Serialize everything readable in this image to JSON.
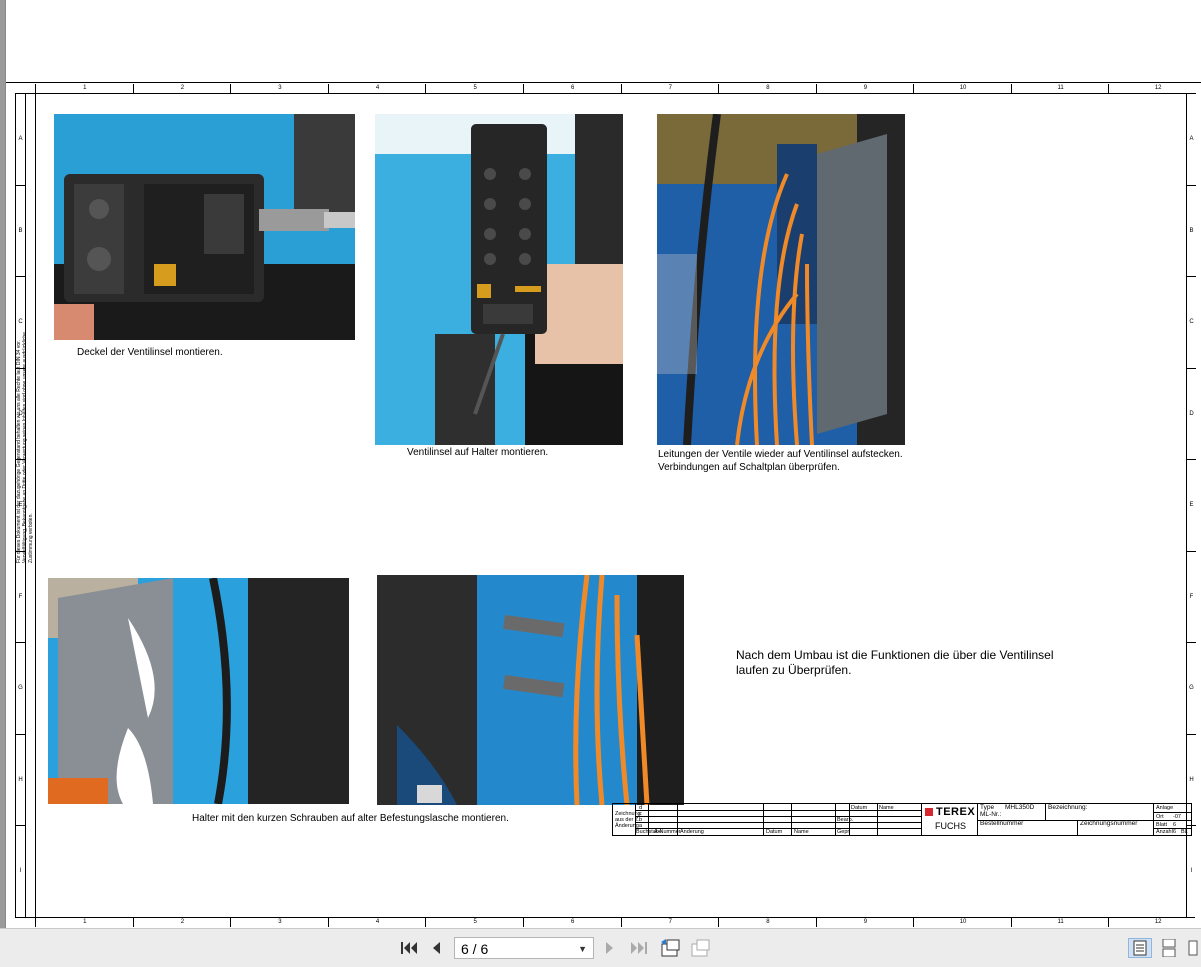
{
  "drawing": {
    "columns": [
      "1",
      "2",
      "3",
      "4",
      "5",
      "6",
      "7",
      "8",
      "9",
      "10",
      "11",
      "12"
    ],
    "rows": [
      "A",
      "B",
      "C",
      "D",
      "E",
      "F",
      "G",
      "H",
      "I"
    ],
    "legal_note_line1": "Für dieses Dokument ist der dazugehörige Gegenstand behalten wir uns alle Rechte laut DIN 34 vor.",
    "legal_note_line2": "Vervielfältigung, Bekanntgabe an Dritte oder Verwertung seines Inhaltes sind ohne unsere ausdrückliche Zustimmung verboten.",
    "captions": {
      "photo1": "Deckel der Ventilinsel montieren.",
      "photo2": "Ventilinsel auf Halter montieren.",
      "photo3_line1": "Leitungen der Ventile wieder auf Ventilinsel aufstecken.",
      "photo3_line2": "Verbindungen auf Schaltplan überprüfen.",
      "photo45": "Halter mit den kurzen Schrauben auf alter Befestungslasche montieren."
    },
    "note_line1": "Nach dem Umbau ist die Funktionen die über die Ventilinsel",
    "note_line2": "laufen zu Überprüfen."
  },
  "title_block": {
    "brand": "TEREX",
    "sub_brand": "FUCHS",
    "type_label": "Type",
    "type_value": "MHL350D",
    "ml_nr_label": "ML-Nr.:",
    "bezeichnung_label": "Bezeichnung:",
    "bestellnummer_label": "Bestellnummer",
    "zeichnungsnummer_label": "Zeichnungsnummer",
    "datum_label": "Datum",
    "name_label": "Name",
    "bearb_label": "Bearb.",
    "gepr_label": "Gepr.",
    "zeichnung_label": "Zeichnung",
    "aus_label": "aus der Z.",
    "anderung_label": "Änderung",
    "rev_d": "d",
    "rev_c": "c",
    "rev_b": "b",
    "rev_a": "a",
    "buchstabe_label": "Buchstabe",
    "a_nummer_label": "A-Nummer",
    "anlage_label": "Anlage",
    "ort_label": "Ort",
    "ort_value": "-07",
    "blatt_label": "Blatt",
    "blatt_value": "6",
    "anzahl_label": "Anzahl",
    "anzahl_value": "6",
    "bl_label": "BL"
  },
  "viewer": {
    "page_indicator": "6 / 6"
  }
}
